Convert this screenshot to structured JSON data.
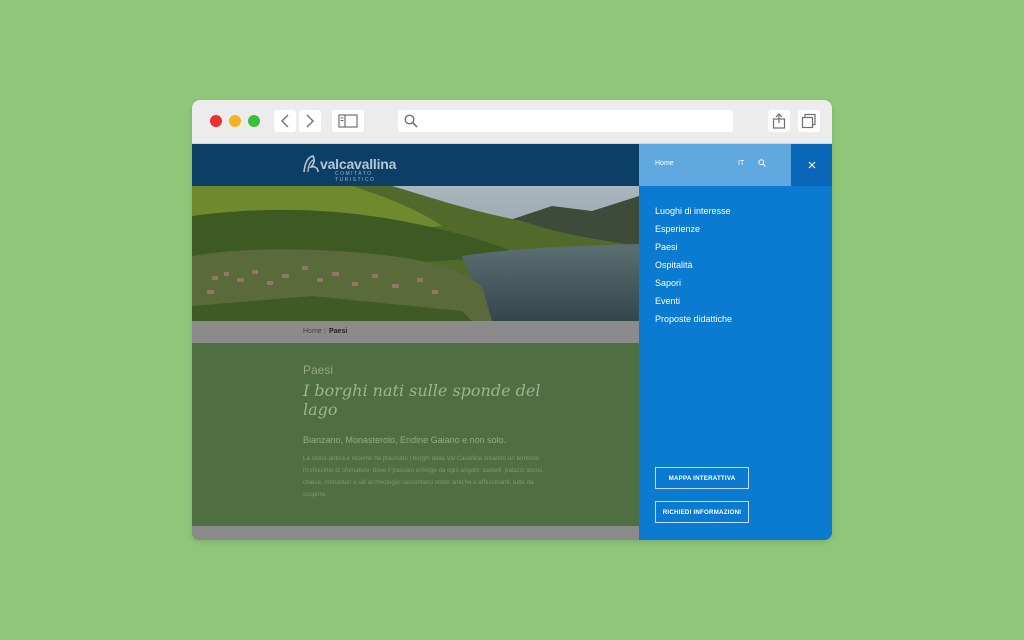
{
  "browser": {
    "address_value": "",
    "icons": [
      "back-icon",
      "forward-icon",
      "sidebar-icon",
      "search-icon",
      "share-icon",
      "tabs-icon"
    ]
  },
  "site": {
    "logo": {
      "name": "valcavallina",
      "subtitle": "COMITATO TURISTICO"
    },
    "breadcrumb": {
      "home": "Home",
      "separator": "|",
      "current": "Paesi"
    },
    "content": {
      "kicker": "Paesi",
      "headline": "I borghi nati sulle sponde del lago",
      "lead": "Bianzano, Monasterolo, Endine Gaiano e non solo.",
      "body": "La storia antica e recente ha plasmato i borghi della Val Cavallina creando un territorio ricchissimo di sfumature, dove il passato emerge da ogni angolo: castelli, palazzi storici, chiese, monasteri e siti archeologici raccontano storie antiche e affascinanti, tutte da scoprire."
    },
    "panel": {
      "home": "Home",
      "language": "IT",
      "menu": [
        "Luoghi di interesse",
        "Esperienze",
        "Paesi",
        "Ospitalità",
        "Sapori",
        "Eventi",
        "Proposte didattiche"
      ],
      "button_map": "MAPPA INTERATTIVA",
      "button_info": "RICHIEDI INFORMAZIONI"
    }
  },
  "colors": {
    "background": "#90c67a",
    "header": "#0b3f66",
    "panel": "#0a7bd1",
    "panel_top": "#5fa8e0",
    "content": "#4f6e41"
  }
}
